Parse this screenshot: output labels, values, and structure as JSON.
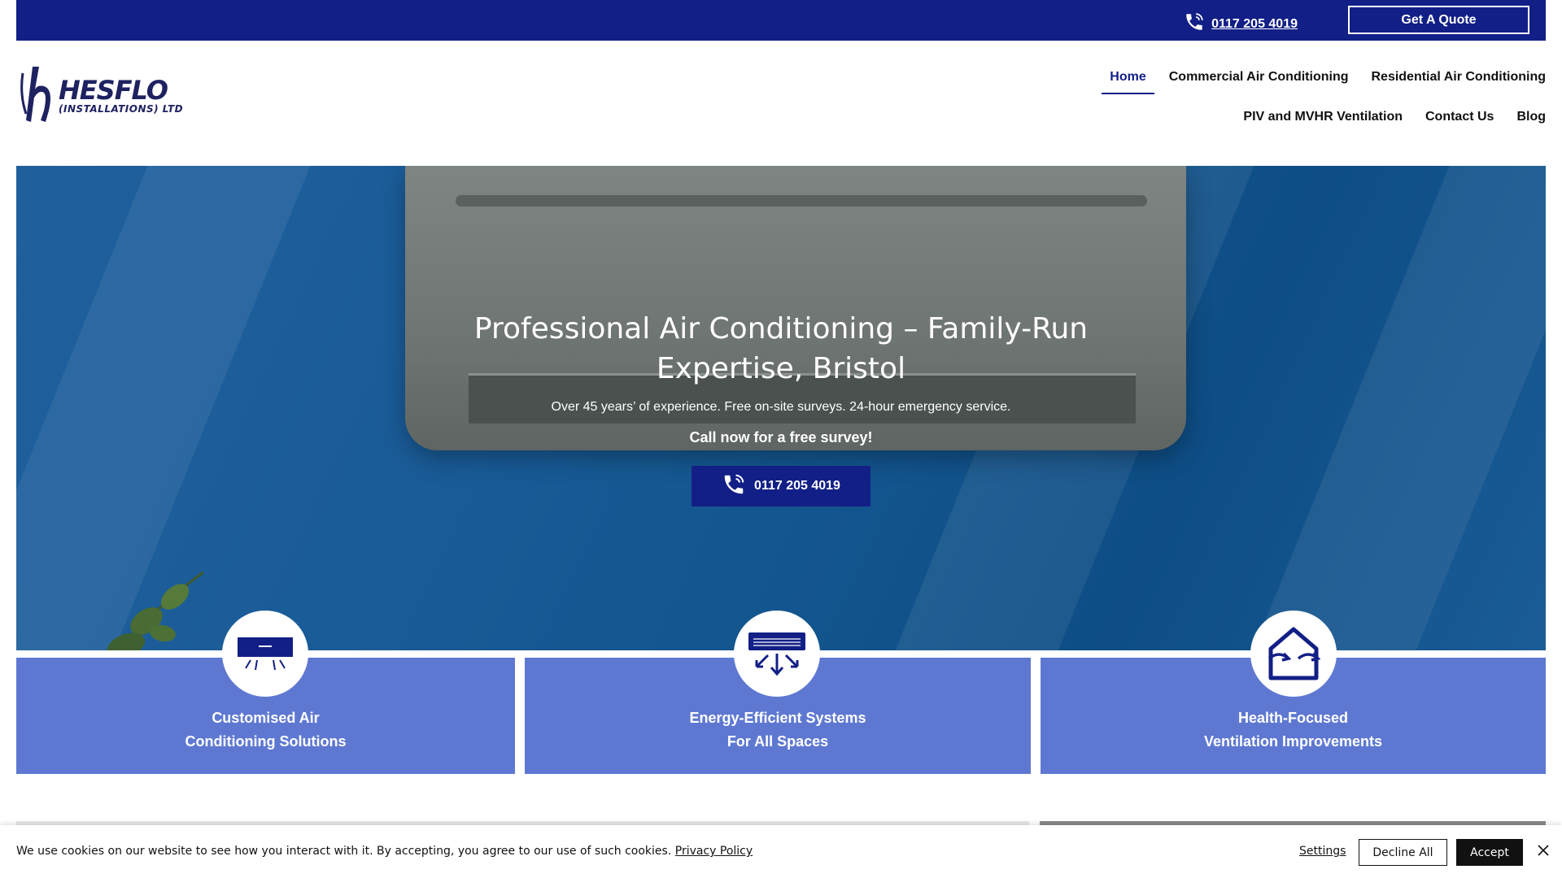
{
  "topbar": {
    "phone_icon": "phone-icon",
    "phone_number": "0117 205 4019",
    "quote_label": "Get A Quote",
    "bg_color": "#121f86"
  },
  "logo": {
    "main": "HESFLO",
    "sub": "(INSTALLATIONS) LTD"
  },
  "nav": {
    "row1": [
      "Home",
      "Commercial Air Conditioning",
      "Residential Air Conditioning"
    ],
    "row2": [
      "PIV and MVHR Ventilation",
      "Contact Us",
      "Blog"
    ],
    "active": "Home"
  },
  "hero": {
    "title": "Professional Air Conditioning – Family-Run Expertise, Bristol",
    "subtitle": "Over 45 years’ of experience. Free on-site surveys. 24-hour emergency service.",
    "cta_text": "Call now for a free survey!",
    "button_label": "0117 205 4019",
    "button_icon": "phone-icon"
  },
  "features": [
    {
      "icon": "air-conditioner-icon",
      "line1": "Customised Air",
      "line2": "Conditioning Solutions"
    },
    {
      "icon": "energy-airflow-icon",
      "line1": "Energy-Efficient Systems",
      "line2": "For All Spaces"
    },
    {
      "icon": "house-ventilation-icon",
      "line1": "Health-Focused",
      "line2": "Ventilation Improvements"
    }
  ],
  "cookie": {
    "message": "We use cookies on our website to see how you interact with it. By accepting, you agree to our use of such cookies.",
    "policy_link": "Privacy Policy",
    "settings_label": "Settings",
    "decline_label": "Decline All",
    "accept_label": "Accept",
    "close_icon": "close-icon"
  },
  "colors": {
    "brand_navy": "#121f86",
    "card_blue": "#5e78d2"
  }
}
